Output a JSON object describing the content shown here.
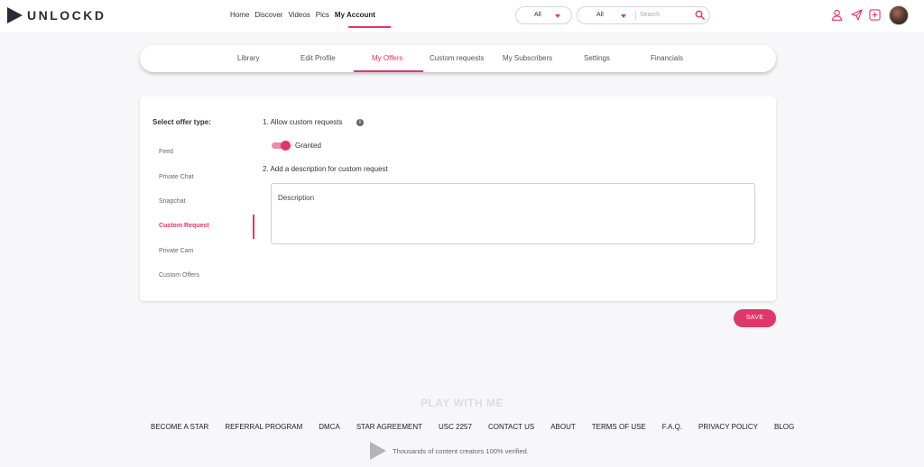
{
  "header": {
    "brand": "UNLOCKD",
    "nav": [
      "Home",
      "Discover",
      "Videos",
      "Pics",
      "My Account"
    ],
    "active_nav": "My Account",
    "filter1_value": "All",
    "filter2_value": "All",
    "search_placeholder": "Search"
  },
  "tabs": {
    "items": [
      "Library",
      "Edit Profile",
      "My Offers",
      "Custom requests",
      "My Subscribers",
      "Settings",
      "Financials"
    ],
    "active": "My Offers"
  },
  "offers": {
    "sidebar_title": "Select offer type:",
    "types": [
      "Feed",
      "Private Chat",
      "Snapchat",
      "Custom Request",
      "Private Cam",
      "Custom Offers"
    ],
    "active_type": "Custom Request",
    "q1": "1. Allow custom requests",
    "info_glyph": "i",
    "toggle_on": true,
    "toggle_label": "Granted",
    "q2": "2. Add a description for custom request",
    "description_value": "Description"
  },
  "save_label": "SAVE",
  "footer": {
    "title": "PLAY WITH ME",
    "links": [
      "BECOME A STAR",
      "REFERRAL PROGRAM",
      "DMCA",
      "STAR AGREEMENT",
      "USC 2257",
      "CONTACT US",
      "ABOUT",
      "TERMS OF USE",
      "F.A.Q.",
      "PRIVACY POLICY",
      "BLOG"
    ],
    "verified_text": "Thousands of content creators 100% verified."
  },
  "colors": {
    "accent": "#e0376b",
    "brand_dark": "#2a2a38",
    "toggle_track": "#f08aa8"
  },
  "icons": [
    "play-logo-icon",
    "chevron-down-icon",
    "search-icon",
    "user-icon",
    "send-icon",
    "add-square-icon",
    "info-icon",
    "play-icon"
  ]
}
